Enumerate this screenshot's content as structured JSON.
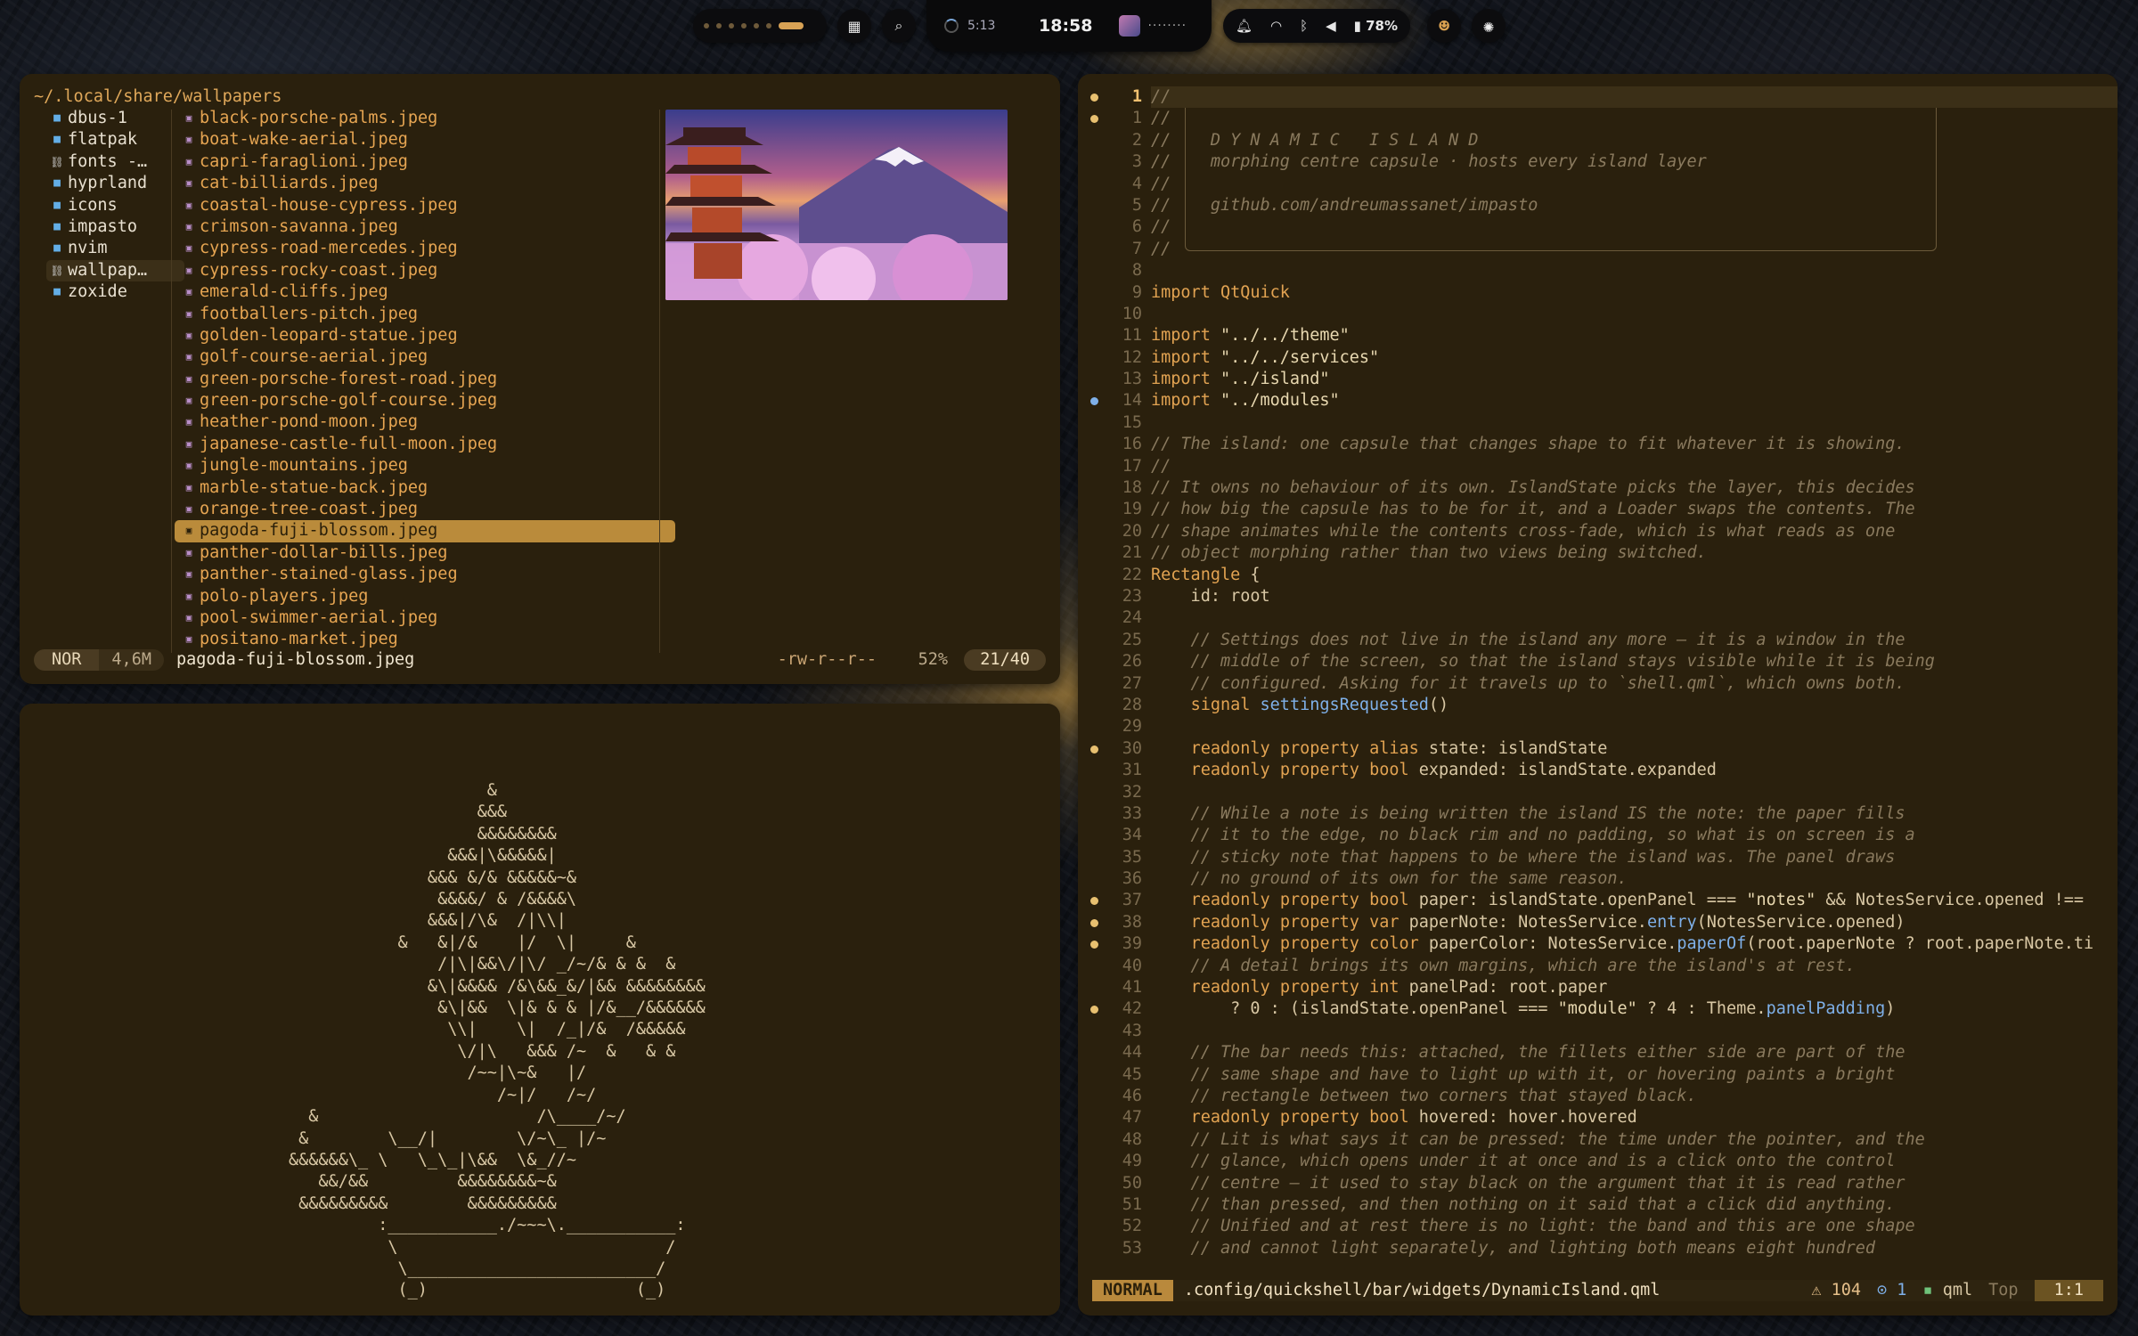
{
  "topbar": {
    "search_icon": "search-icon",
    "island": {
      "timer": "5:13",
      "clock": "18:58",
      "media": "········"
    },
    "battery": "78%"
  },
  "yazi": {
    "path": "~/.local/share/wallpapers",
    "parent": [
      {
        "name": "dbus-1",
        "icon": "folder"
      },
      {
        "name": "flatpak",
        "icon": "folder"
      },
      {
        "name": "fonts -…",
        "icon": "symlink"
      },
      {
        "name": "hyprland",
        "icon": "folder"
      },
      {
        "name": "icons",
        "icon": "folder"
      },
      {
        "name": "impasto",
        "icon": "folder"
      },
      {
        "name": "nvim",
        "icon": "folder"
      },
      {
        "name": "wallpap…",
        "icon": "symlink"
      },
      {
        "name": "zoxide",
        "icon": "folder"
      }
    ],
    "files": [
      "black-porsche-palms.jpeg",
      "boat-wake-aerial.jpeg",
      "capri-faraglioni.jpeg",
      "cat-billiards.jpeg",
      "coastal-house-cypress.jpeg",
      "crimson-savanna.jpeg",
      "cypress-road-mercedes.jpeg",
      "cypress-rocky-coast.jpeg",
      "emerald-cliffs.jpeg",
      "footballers-pitch.jpeg",
      "golden-leopard-statue.jpeg",
      "golf-course-aerial.jpeg",
      "green-porsche-forest-road.jpeg",
      "green-porsche-golf-course.jpeg",
      "heather-pond-moon.jpeg",
      "japanese-castle-full-moon.jpeg",
      "jungle-mountains.jpeg",
      "marble-statue-back.jpeg",
      "orange-tree-coast.jpeg",
      "pagoda-fuji-blossom.jpeg",
      "panther-dollar-bills.jpeg",
      "panther-stained-glass.jpeg",
      "polo-players.jpeg",
      "pool-swimmer-aerial.jpeg",
      "positano-market.jpeg"
    ],
    "selected_index": 19,
    "status": {
      "mode": "NOR",
      "size": "4,6M",
      "filename": "pagoda-fuji-blossom.jpeg",
      "perms": "-rw-r--r--",
      "percent": "52%",
      "position": "21/40"
    }
  },
  "ascii_art": "                    &\n                   &&&\n                   &&&&&&&&\n                &&&|\\&&&&&|\n              &&& &/& &&&&&~&\n               &&&&/ & /&&&&\\\n              &&&|/\\&  /|\\\\|\n           &   &|/&    |/  \\|     &\n               /|\\|&&\\/|\\/ _/~/& & &  &\n              &\\|&&&& /&\\&&_&/|&& &&&&&&&&\n               &\\|&&  \\|& & & |/&__/&&&&&&\n                \\\\|    \\|  /_|/&  /&&&&&\n                 \\/|\\   &&& /~  &   & &\n                  /~~|\\~&   |/\n                     /~|/   /~/\n  &                      /\\____/~/\n &        \\__/|        \\/~\\_ |/~\n&&&&&&\\_ \\   \\_\\_|\\&&  \\&_//~\n   &&/&&         &&&&&&&&~&\n &&&&&&&&&        &&&&&&&&&\n         :___________./~~~\\.___________:\n          \\                           /\n           \\_________________________/\n           (_)                     (_)",
  "nvim": {
    "start_line": 1,
    "lines": [
      "//",
      "//",
      "//    D Y N A M I C   I S L A N D",
      "//    morphing centre capsule · hosts every island layer",
      "//",
      "//    github.com/andreumassanet/impasto",
      "//",
      "//",
      "",
      "import QtQuick",
      "",
      "import \"../../theme\"",
      "import \"../../services\"",
      "import \"../island\"",
      "import \"../modules\"",
      "",
      "// The island: one capsule that changes shape to fit whatever it is showing.",
      "//",
      "// It owns no behaviour of its own. IslandState picks the layer, this decides",
      "// how big the capsule has to be for it, and a Loader swaps the contents. The",
      "// shape animates while the contents cross-fade, which is what reads as one",
      "// object morphing rather than two views being switched.",
      "Rectangle {",
      "    id: root",
      "",
      "    // Settings does not live in the island any more — it is a window in the",
      "    // middle of the screen, so that the island stays visible while it is being",
      "    // configured. Asking for it travels up to `shell.qml`, which owns both.",
      "    signal settingsRequested()",
      "",
      "    readonly property alias state: islandState",
      "    readonly property bool expanded: islandState.expanded",
      "",
      "    // While a note is being written the island IS the note: the paper fills",
      "    // it to the edge, no black rim and no padding, so what is on screen is a",
      "    // sticky note that happens to be where the island was. The panel draws",
      "    // no ground of its own for the same reason.",
      "    readonly property bool paper: islandState.openPanel === \"notes\" && NotesService.opened !==",
      "    readonly property var paperNote: NotesService.entry(NotesService.opened)",
      "    readonly property color paperColor: NotesService.paperOf(root.paperNote ? root.paperNote.ti",
      "    // A detail brings its own margins, which are the island's at rest.",
      "    readonly property int panelPad: root.paper",
      "        ? 0 : (islandState.openPanel === \"module\" ? 4 : Theme.panelPadding)",
      "",
      "    // The bar needs this: attached, the fillets either side are part of the",
      "    // same shape and have to light up with it, or hovering paints a bright",
      "    // rectangle between two corners that stayed black.",
      "    readonly property bool hovered: hover.hovered",
      "    // Lit is what says it can be pressed: the time under the pointer, and the",
      "    // glance, which opens under it at once and is a click onto the control",
      "    // centre — it used to stay black on the argument that it is read rather",
      "    // than pressed, and then nothing on it said that a click did anything.",
      "    // Unified and at rest there is no light: the band and this are one shape",
      "    // and cannot light separately, and lighting both means eight hundred"
    ],
    "signs": {
      "1": "#e8c070",
      "14": "#7fb0e8",
      "30": "#e8c070",
      "37": "#e8c070",
      "38": "#e8c070",
      "39": "#e8c070",
      "42": "#e8c070"
    },
    "status": {
      "mode": "NORMAL",
      "file": ".config/quickshell/bar/widgets/DynamicIsland.qml",
      "warnings": "⚠ 104",
      "info": "⊙ 1",
      "filetype": "qml",
      "scroll": "Top",
      "cursor": "1:1"
    }
  }
}
